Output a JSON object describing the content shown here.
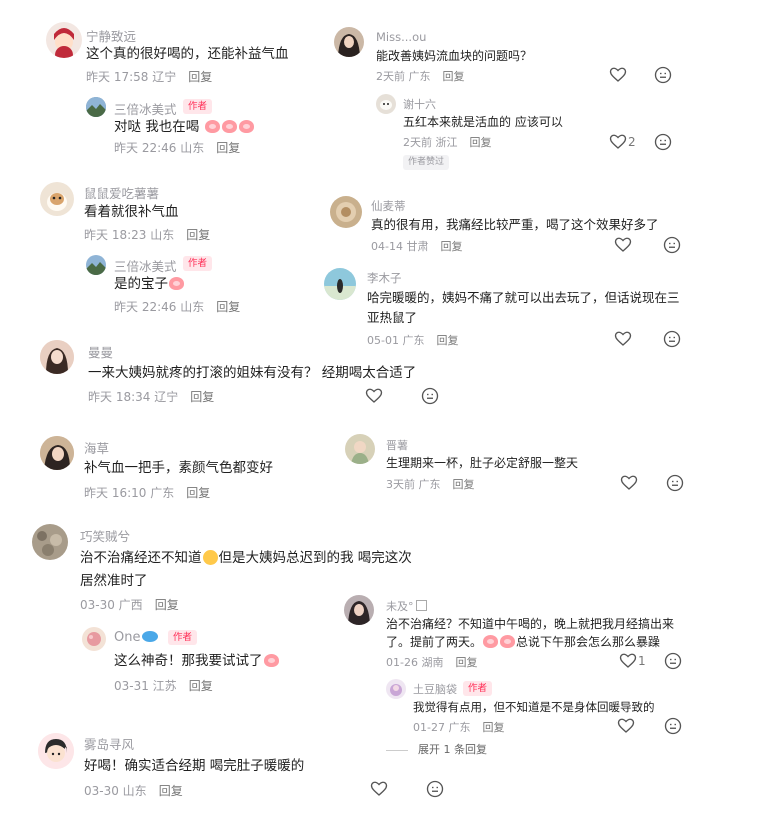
{
  "left_column": {
    "c1": {
      "name": "宁静致远",
      "text": "这个真的很好喝的，还能补益气血",
      "time": "昨天 17:58 辽宁",
      "reply": "回复"
    },
    "c1r": {
      "name": "三倍冰美式",
      "badge": "作者",
      "text": "对哒 我也在喝",
      "time": "昨天 22:46 山东",
      "reply": "回复"
    },
    "c2": {
      "name": "鼠鼠爱吃薯薯",
      "text": "看着就很补气血",
      "time": "昨天 18:23 山东",
      "reply": "回复"
    },
    "c2r": {
      "name": "三倍冰美式",
      "badge": "作者",
      "text": "是的宝子",
      "time": "昨天 22:46 山东",
      "reply": "回复"
    },
    "c3": {
      "name": "曼曼",
      "text": "一来大姨妈就疼的打滚的姐妹有没有？ 经期喝太合适了",
      "time": "昨天 18:34 辽宁",
      "reply": "回复"
    },
    "c4": {
      "name": "海草",
      "text": "补气血一把手，素颜气色都变好",
      "time": "昨天 16:10 广东",
      "reply": "回复"
    },
    "c5": {
      "name": "巧笑贼兮",
      "text1": "治不治痛经还不知道",
      "text2": "但是大姨妈总迟到的我  喝完这次",
      "text3": "居然准时了",
      "time": "03-30 广西",
      "reply": "回复"
    },
    "c5r": {
      "name": "One",
      "badge": "作者",
      "text": "这么神奇！那我要试试了",
      "time": "03-31 江苏",
      "reply": "回复"
    },
    "c6": {
      "name": "雾岛寻风",
      "text": "好喝！确实适合经期 喝完肚子暖暖的",
      "time": "03-30 山东",
      "reply": "回复"
    }
  },
  "right_column": {
    "r1": {
      "name": "Miss...ou",
      "text": "能改善姨妈流血块的问题吗？",
      "time": "2天前 广东",
      "reply": "回复"
    },
    "r1r": {
      "name": "谢十六",
      "text": "五红本来就是活血的 应该可以",
      "time": "2天前 浙江",
      "reply": "回复",
      "likes": "2",
      "tag": "作者赞过"
    },
    "r2": {
      "name": "仙麦蒂",
      "text": "真的很有用，我痛经比较严重，喝了这个效果好多了",
      "time": "04-14 甘肃",
      "reply": "回复"
    },
    "r3": {
      "name": "李木子",
      "text1": "哈完暖暖的，姨妈不痛了就可以出去玩了，但话说现在三",
      "text2": "亚热鼠了",
      "time": "05-01 广东",
      "reply": "回复"
    },
    "r4": {
      "name": "晋薯",
      "text": "生理期来一杯，肚子必定舒服一整天",
      "time": "3天前 广东",
      "reply": "回复"
    },
    "r5": {
      "name": "未及°",
      "text1": "治不治痛经？不知道中午喝的，晚上就把我月经搞出来",
      "text2": "了。提前了两天。",
      "text3": "总说下午那会怎么那么暴躁",
      "time": "01-26 湖南",
      "reply": "回复",
      "likes": "1"
    },
    "r5r": {
      "name": "土豆脑袋",
      "badge": "作者",
      "text": "我觉得有点用，但不知道是不是身体回暖导致的",
      "time": "01-27 广东",
      "reply": "回复"
    },
    "expand": "展开 1 条回复"
  },
  "colors": {
    "accent": "#ff2d55",
    "meta": "#9a9aa0",
    "text": "#1f1f1f"
  },
  "icons": [
    "heart-outline-icon",
    "face-outline-icon",
    "peach-emoji",
    "smile-emoji",
    "fish-emoji"
  ]
}
